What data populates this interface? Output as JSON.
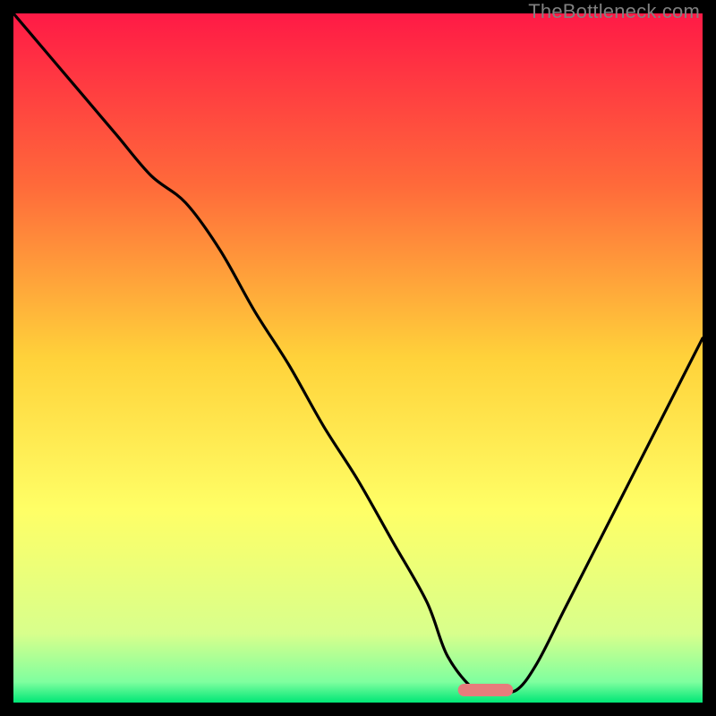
{
  "watermark": "TheBottleneck.com",
  "chart_data": {
    "type": "line",
    "title": "",
    "xlabel": "",
    "ylabel": "",
    "xlim": [
      0,
      100
    ],
    "ylim": [
      0,
      100
    ],
    "grid": false,
    "legend": false,
    "background_gradient_stops": [
      {
        "pct": 0.0,
        "color": "#ff1a46"
      },
      {
        "pct": 0.25,
        "color": "#ff6a3a"
      },
      {
        "pct": 0.5,
        "color": "#ffd23a"
      },
      {
        "pct": 0.72,
        "color": "#ffff66"
      },
      {
        "pct": 0.9,
        "color": "#d8ff8c"
      },
      {
        "pct": 0.97,
        "color": "#7fff9f"
      },
      {
        "pct": 1.0,
        "color": "#00e676"
      }
    ],
    "series": [
      {
        "name": "bottleneck-curve",
        "x": [
          0,
          5,
          10,
          15,
          20,
          25,
          30,
          35,
          40,
          45,
          50,
          55,
          60,
          63,
          67,
          70,
          73,
          76,
          80,
          85,
          90,
          95,
          100
        ],
        "values": [
          100,
          94,
          88,
          82,
          76,
          72,
          65,
          56,
          48,
          39,
          31,
          22,
          13,
          5,
          0,
          0,
          0,
          4,
          12,
          22,
          32,
          42,
          52
        ]
      }
    ],
    "markers": [
      {
        "name": "optimal-marker",
        "shape": "capsule",
        "color": "#e77c7c",
        "x_center": 68.5,
        "y_value": 0,
        "x_half_width": 4
      }
    ]
  }
}
